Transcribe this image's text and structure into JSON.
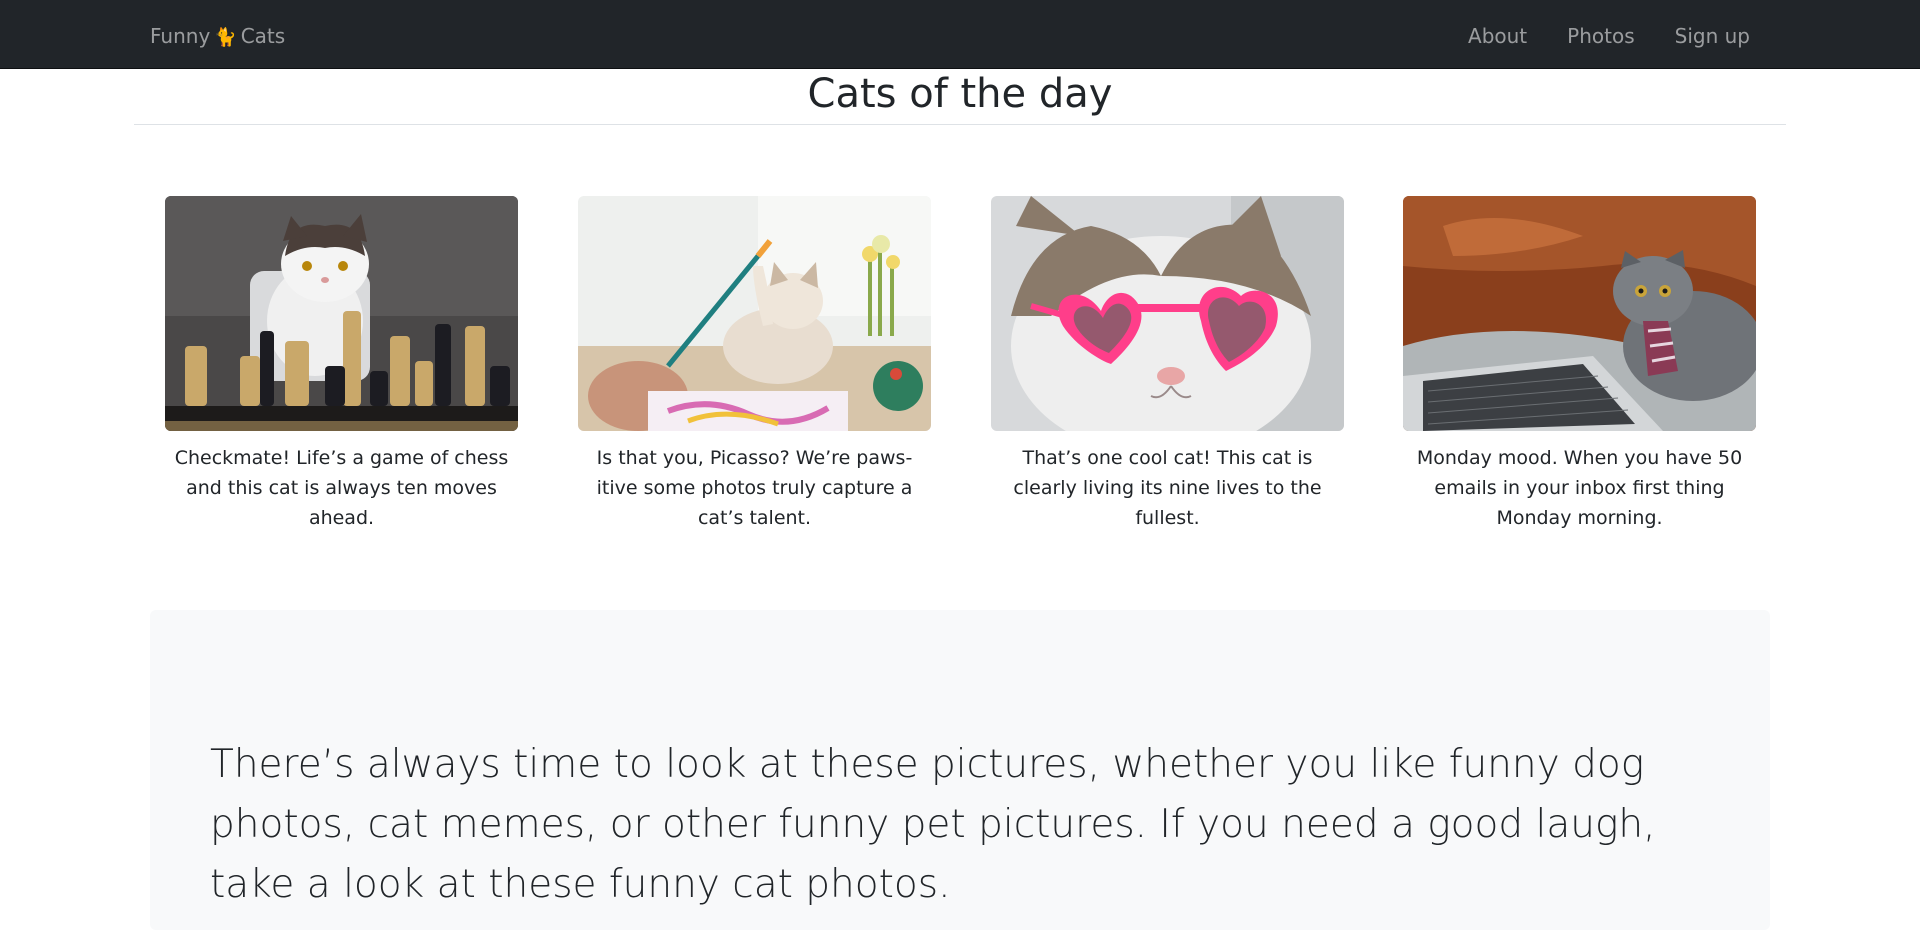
{
  "navbar": {
    "brand_left": "Funny",
    "brand_emoji": "🐈",
    "brand_right": "Cats",
    "links": [
      "About",
      "Photos",
      "Sign up"
    ]
  },
  "page": {
    "title": "Cats of the day"
  },
  "cards": [
    {
      "caption": "Checkmate! Life’s a game of chess and this cat is always ten moves ahead.",
      "image": "cat-playing-chess-photo"
    },
    {
      "caption": "Is that you, Picasso? We’re paws-itive some photos truly capture a cat’s talent.",
      "image": "cat-painting-photo"
    },
    {
      "caption": "That’s one cool cat! This cat is clearly living its nine lives to the fullest.",
      "image": "cat-heart-sunglasses-photo"
    },
    {
      "caption": "Monday mood. When you have 50 emails in your inbox first thing Monday morning.",
      "image": "cat-laptop-tie-photo"
    }
  ],
  "jumbotron": {
    "lead": "There’s always time to look at these pictures, whether you like funny dog photos, cat memes, or other funny pet pictures. If you need a good laugh, take a look at these funny cat photos."
  },
  "colors": {
    "navbar_bg": "#212529",
    "nav_text": "rgba(255,255,255,0.55)",
    "jumbotron_bg": "#f8f9fa"
  }
}
